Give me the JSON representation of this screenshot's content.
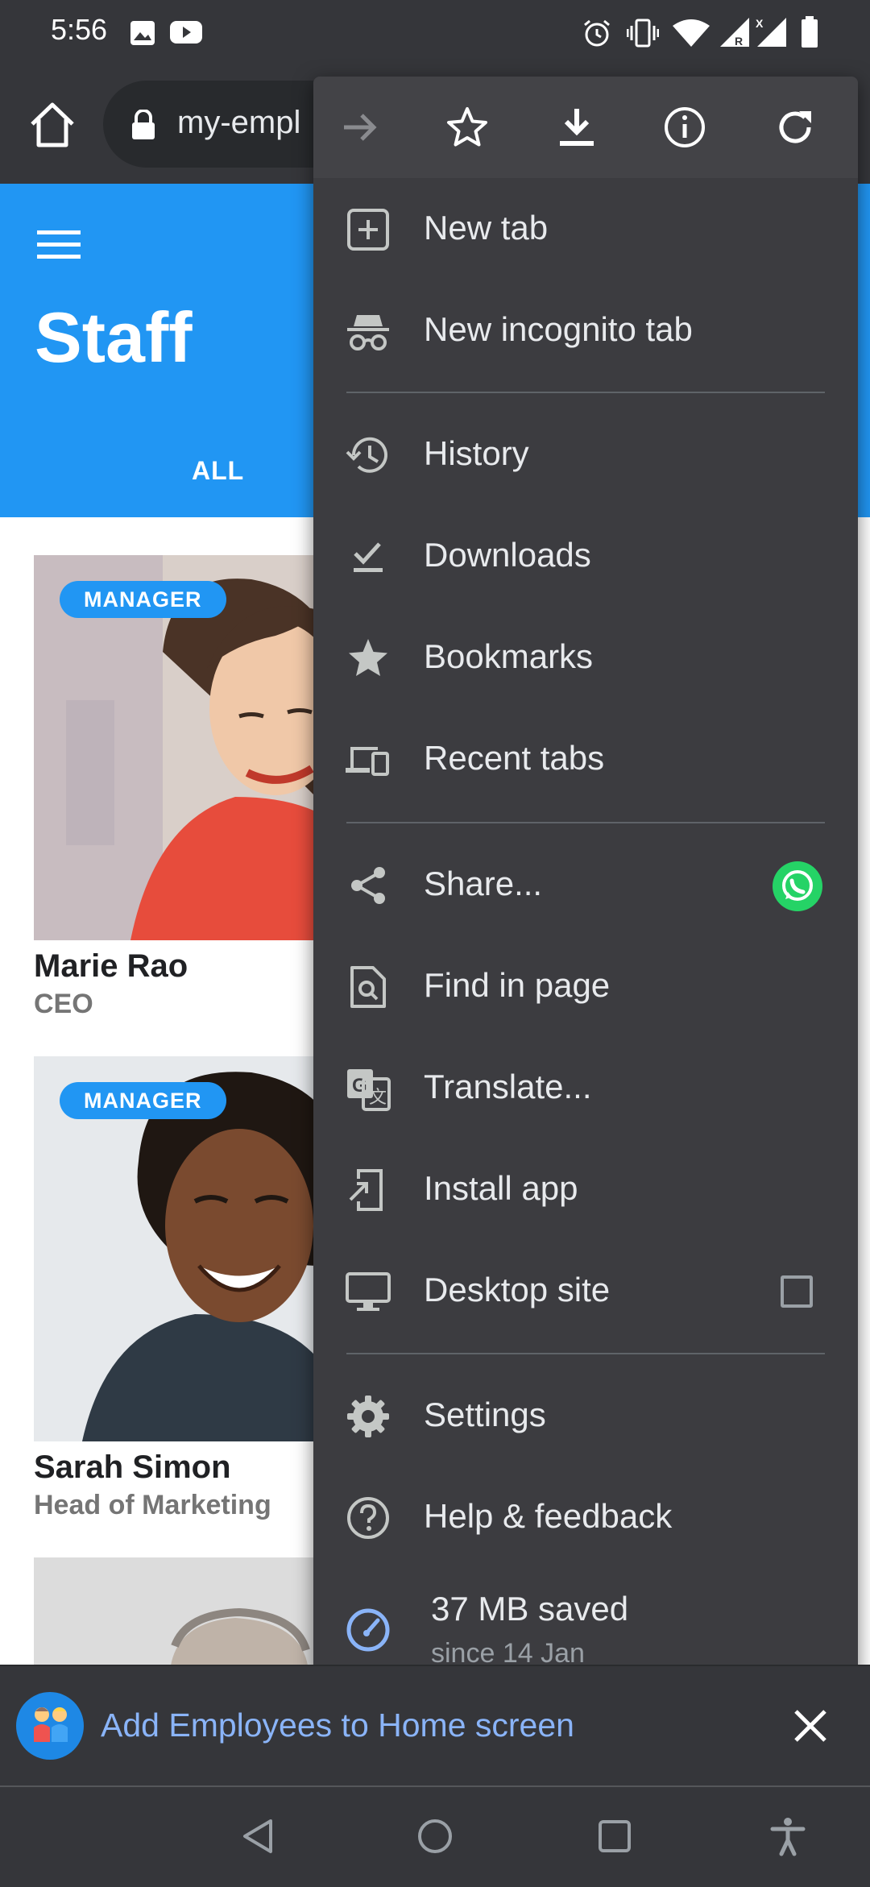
{
  "status_bar": {
    "time": "5:56"
  },
  "browser": {
    "url_text": "my-empl"
  },
  "page": {
    "title": "Staff",
    "tabs": [
      {
        "label": "ALL"
      }
    ],
    "cards": [
      {
        "badge": "MANAGER",
        "name": "Marie Rao",
        "role": "CEO"
      },
      {
        "badge": "MANAGER",
        "name": "Sarah Simon",
        "role": "Head of Marketing"
      }
    ]
  },
  "menu": {
    "items": {
      "new_tab": "New tab",
      "new_incognito_tab": "New incognito tab",
      "history": "History",
      "downloads": "Downloads",
      "bookmarks": "Bookmarks",
      "recent_tabs": "Recent tabs",
      "share": "Share...",
      "find_in_page": "Find in page",
      "translate": "Translate...",
      "install_app": "Install app",
      "desktop_site": "Desktop site",
      "settings": "Settings",
      "help_feedback": "Help & feedback"
    },
    "data_saver": {
      "amount": "37 MB saved",
      "since": "since 14 Jan"
    }
  },
  "banner": {
    "text": "Add Employees to Home screen"
  },
  "colors": {
    "header_blue": "#2196f3",
    "menu_bg": "#3c3c40",
    "toolbar_bg": "#35363a",
    "link_blue": "#8ab4f8",
    "whatsapp_green": "#25d366"
  },
  "icons": [
    "home-icon",
    "lock-icon",
    "forward-icon",
    "star-icon",
    "download-icon",
    "info-icon",
    "reload-icon",
    "new-tab-icon",
    "incognito-icon",
    "history-icon",
    "downloads-icon",
    "bookmarks-icon",
    "recent-tabs-icon",
    "share-icon",
    "whatsapp-icon",
    "find-in-page-icon",
    "translate-icon",
    "install-app-icon",
    "desktop-site-icon",
    "settings-icon",
    "help-icon",
    "data-saver-icon",
    "close-icon",
    "back-nav-icon",
    "home-nav-icon",
    "recents-nav-icon",
    "accessibility-icon"
  ]
}
